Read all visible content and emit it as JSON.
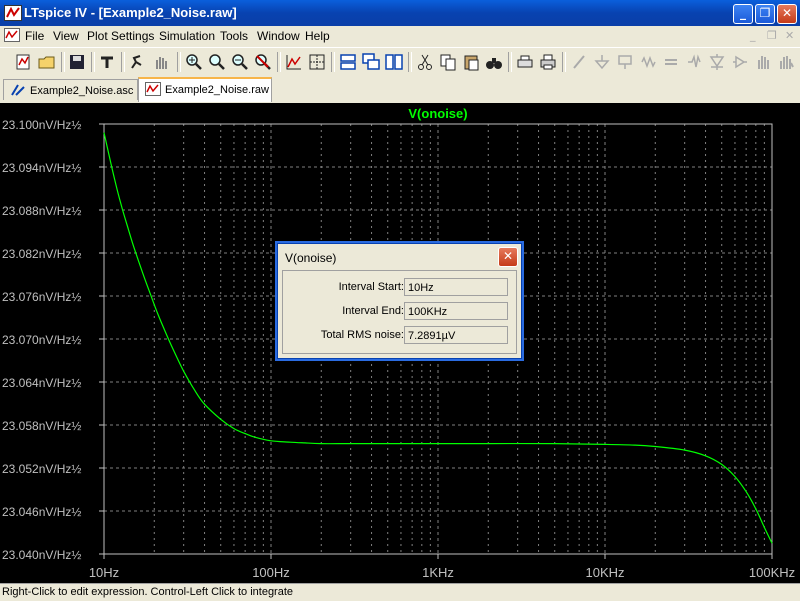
{
  "window": {
    "title": "LTspice IV - [Example2_Noise.raw]",
    "controls": {
      "minimize": "_",
      "maximize": "❐",
      "close": "✕"
    }
  },
  "menu": {
    "items": [
      "File",
      "View",
      "Plot Settings",
      "Simulation",
      "Tools",
      "Window",
      "Help"
    ]
  },
  "toolbar": {
    "icons": [
      "new-schematic-icon",
      "open-icon",
      "save-icon",
      "control-panel-icon",
      "run-icon",
      "pan-icon",
      "zoom-in-icon",
      "zoom-out-icon",
      "zoom-fit-icon",
      "zoom-cancel-icon",
      "autorange-icon",
      "grid-icon",
      "tile-horizontal-icon",
      "cascade-icon",
      "tile-vertical-icon",
      "cut-icon",
      "copy-icon",
      "paste-icon",
      "find-icon",
      "print-setup-icon",
      "print-icon",
      "wire-icon",
      "ground-icon",
      "label-icon",
      "resistor-icon",
      "capacitor-icon",
      "inductor-icon",
      "diode-icon",
      "component-icon",
      "move-icon",
      "drag-icon"
    ]
  },
  "tabs": [
    {
      "label": "Example2_Noise.asc",
      "active": false
    },
    {
      "label": "Example2_Noise.raw",
      "active": true
    }
  ],
  "chart_data": {
    "type": "line",
    "title": "V(onoise)",
    "x_scale": "log",
    "xlim": [
      10,
      100000
    ],
    "ylim": [
      23.04,
      23.1
    ],
    "y_ticks": [
      "23.100nV/Hz½",
      "23.094nV/Hz½",
      "23.088nV/Hz½",
      "23.082nV/Hz½",
      "23.076nV/Hz½",
      "23.070nV/Hz½",
      "23.064nV/Hz½",
      "23.058nV/Hz½",
      "23.052nV/Hz½",
      "23.046nV/Hz½",
      "23.040nV/Hz½"
    ],
    "x_ticks": [
      "10Hz",
      "100Hz",
      "1KHz",
      "10KHz",
      "100KHz"
    ],
    "grid": true,
    "series": [
      {
        "name": "V(onoise)",
        "color": "#00ff00",
        "x": [
          10,
          11,
          12,
          13,
          14,
          15,
          17,
          19,
          21,
          24,
          27,
          30,
          35,
          40,
          50,
          60,
          70,
          80,
          100,
          130,
          160,
          200,
          300,
          500,
          1000,
          2000,
          5000,
          10000,
          15000,
          20000,
          30000,
          40000,
          50000,
          60000,
          70000,
          80000,
          90000,
          100000
        ],
        "y": [
          23.0988,
          23.0945,
          23.0908,
          23.0878,
          23.0853,
          23.083,
          23.0793,
          23.0762,
          23.0735,
          23.0703,
          23.0677,
          23.0655,
          23.0628,
          23.0609,
          23.0588,
          23.0575,
          23.0568,
          23.0563,
          23.0558,
          23.0556,
          23.0555,
          23.0554,
          23.0554,
          23.0554,
          23.0554,
          23.0554,
          23.0554,
          23.0553,
          23.0552,
          23.055,
          23.0545,
          23.0537,
          23.0525,
          23.0508,
          23.0487,
          23.0463,
          23.0437,
          23.0415
        ]
      }
    ]
  },
  "dialog": {
    "title": "V(onoise)",
    "close": "✕",
    "rows": [
      {
        "label": "Interval Start:",
        "value": "10Hz"
      },
      {
        "label": "Interval End:",
        "value": "100KHz"
      },
      {
        "label": "Total RMS noise:",
        "value": "7.2891µV"
      }
    ]
  },
  "status": {
    "text": "Right-Click to edit expression. Control-Left Click to integrate"
  }
}
